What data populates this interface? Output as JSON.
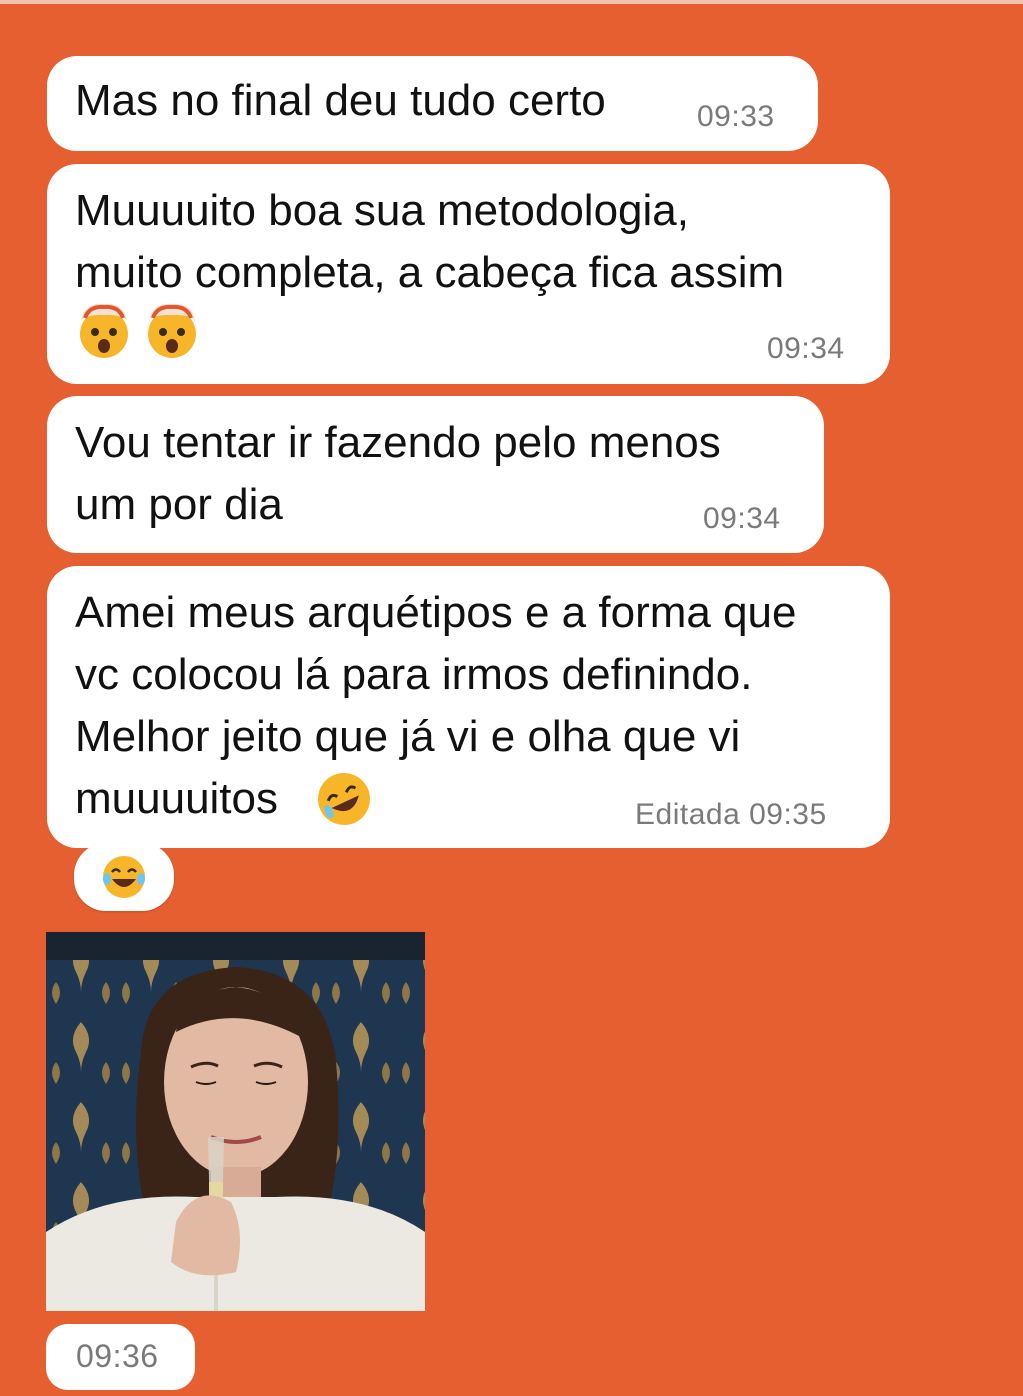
{
  "chat": {
    "messages": [
      {
        "text": "Mas no final deu tudo certo",
        "time": "09:33"
      },
      {
        "text": "Muuuuito boa sua metodologia,\nmuito completa, a cabeça fica assim",
        "emojis": [
          "exploding-head",
          "exploding-head"
        ],
        "time": "09:34"
      },
      {
        "text": "Vou tentar ir fazendo pelo menos\num por dia",
        "time": "09:34"
      },
      {
        "text": "Amei meus arquétipos e a forma que\nvc colocou lá para irmos definindo.\nMelhor jeito que já vi e olha que vi\nmuuuuitos",
        "emoji": "rolling-on-floor-laughing",
        "time": "Editada 09:35"
      }
    ],
    "reaction": "face-with-tears-of-joy",
    "gif_message": {
      "time": "09:36"
    }
  },
  "colors": {
    "background": "#e65f30",
    "bubble": "#ffffff",
    "timestamp": "#7a7a7a"
  }
}
